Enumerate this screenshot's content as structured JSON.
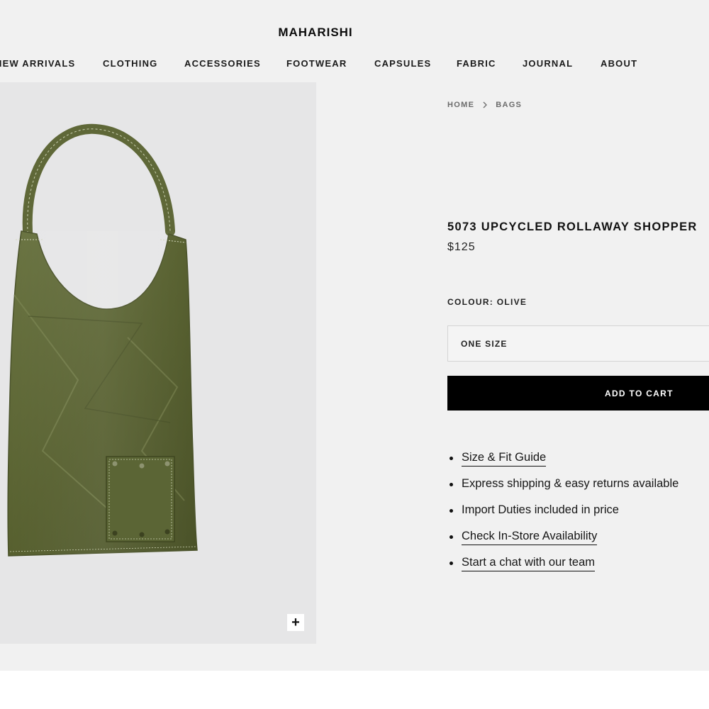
{
  "brand": {
    "name": "MAHARISHI"
  },
  "nav": {
    "items": [
      "NEW ARRIVALS",
      "CLOTHING",
      "ACCESSORIES",
      "FOOTWEAR",
      "CAPSULES",
      "FABRIC",
      "JOURNAL",
      "ABOUT"
    ]
  },
  "breadcrumb": {
    "home": "HOME",
    "current": "BAGS"
  },
  "product": {
    "title": "5073  UPCYCLED ROLLAWAY SHOPPER",
    "price": "$125",
    "colour": "COLOUR: OLIVE",
    "size": "ONE SIZE",
    "add_to_cart": "ADD TO CART",
    "image_color": "#5b6535"
  },
  "gallery": {
    "zoom_label": "+"
  },
  "info": {
    "size_guide": "Size & Fit Guide",
    "shipping": "Express shipping & easy returns available",
    "duties": "Import Duties included in price",
    "availability": "Check In-Store Availability",
    "chat": "Start a chat with our team"
  },
  "colors": {
    "background": "#f1f1f1",
    "gallery_bg": "#e6e6e7",
    "button": "#000000"
  }
}
